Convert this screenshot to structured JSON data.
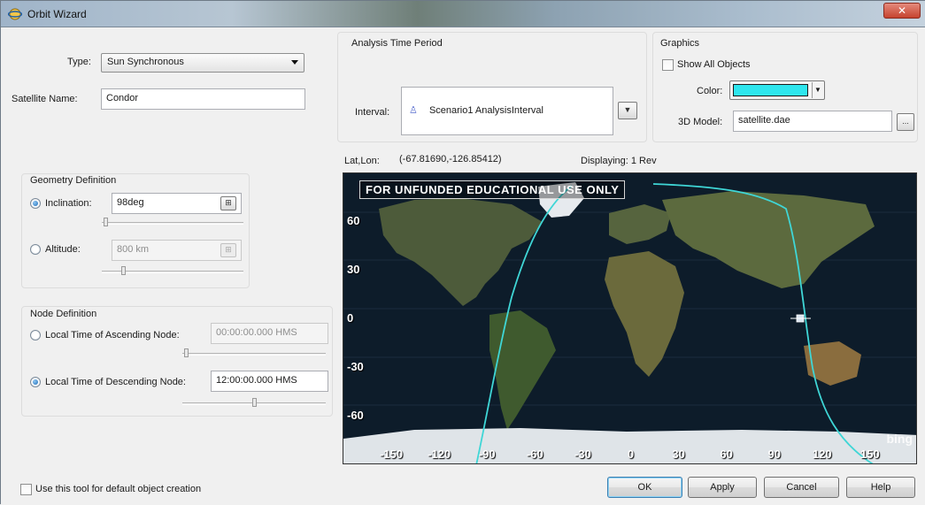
{
  "window": {
    "title": "Orbit Wizard"
  },
  "type": {
    "label": "Type:",
    "value": "Sun Synchronous"
  },
  "satellite_name": {
    "label": "Satellite Name:",
    "value": "Condor"
  },
  "analysis": {
    "group_title": "Analysis Time Period",
    "interval_label": "Interval:",
    "interval_value": "Scenario1 AnalysisInterval"
  },
  "graphics": {
    "group_title": "Graphics",
    "show_all_label": "Show All Objects",
    "color_label": "Color:",
    "color_value": "#2ee6ee",
    "model_label": "3D Model:",
    "model_value": "satellite.dae",
    "browse_label": "..."
  },
  "map_header": {
    "latlon_label": "Lat,Lon:",
    "latlon_value": "(-67.81690,-126.85412)",
    "displaying": "Displaying: 1 Rev"
  },
  "geometry": {
    "group_title": "Geometry Definition",
    "inclination_label": "Inclination:",
    "inclination_value": "98deg",
    "altitude_label": "Altitude:",
    "altitude_value": "800 km"
  },
  "node": {
    "group_title": "Node Definition",
    "ascending_label": "Local Time of Ascending Node:",
    "ascending_value": "00:00:00.000 HMS",
    "descending_label": "Local Time of Descending Node:",
    "descending_value": "12:00:00.000 HMS"
  },
  "map": {
    "watermark": "FOR UNFUNDED EDUCATIONAL USE ONLY",
    "lat_ticks": [
      "60",
      "30",
      "0",
      "-30",
      "-60"
    ],
    "lon_ticks": [
      "-150",
      "-120",
      "-90",
      "-60",
      "-30",
      "0",
      "30",
      "60",
      "90",
      "120",
      "150"
    ],
    "logo": "bing",
    "track_color": "#3fd6d6"
  },
  "footer": {
    "default_checkbox_label": "Use this tool for default object creation",
    "ok": "OK",
    "apply": "Apply",
    "cancel": "Cancel",
    "help": "Help"
  }
}
